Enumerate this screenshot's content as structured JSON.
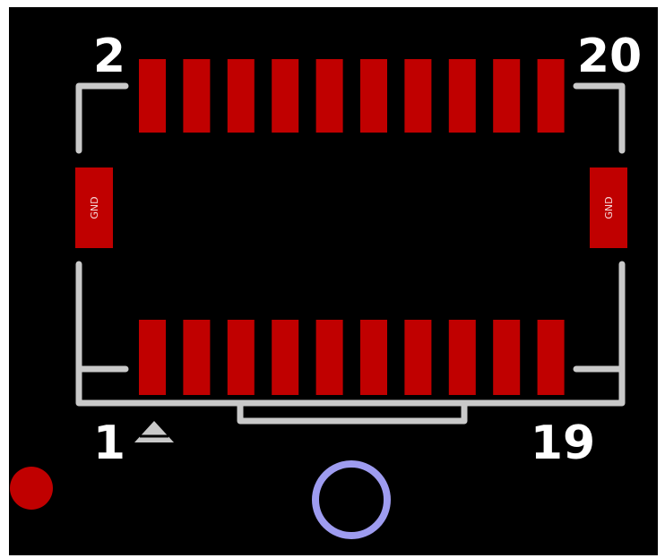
{
  "footprint": {
    "pin_labels": {
      "top_left": "2",
      "top_right": "20",
      "bottom_left": "1",
      "bottom_right": "19"
    },
    "side_pad_text": "GND",
    "top_row_pad_count": 10,
    "bottom_row_pad_count": 10
  },
  "colors": {
    "background": "#000000",
    "pad": "#c00000",
    "silkscreen": "#c9c9c9",
    "label": "#ffffff",
    "fiducial": "#c00000",
    "drill_ring": "#9e9cf0"
  }
}
